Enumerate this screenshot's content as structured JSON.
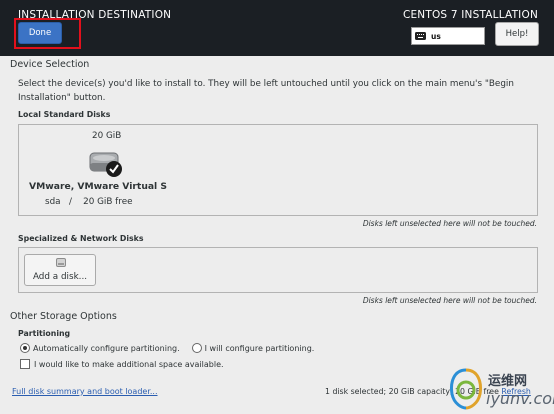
{
  "header": {
    "title": "INSTALLATION DESTINATION",
    "product": "CENTOS 7 INSTALLATION",
    "done_label": "Done",
    "keyboard_layout": "us",
    "help_label": "Help!"
  },
  "device_selection": {
    "title": "Device Selection",
    "description": "Select the device(s) you'd like to install to.  They will be left untouched until you click on the main menu's \"Begin Installation\" button.",
    "local_disks_title": "Local Standard Disks",
    "disk": {
      "size": "20 GiB",
      "name": "VMware, VMware Virtual S",
      "info": "sda   /    20 GiB free"
    },
    "local_note": "Disks left unselected here will not be touched.",
    "network_title": "Specialized & Network Disks",
    "add_disk_label": "Add a disk...",
    "network_note": "Disks left unselected here will not be touched."
  },
  "other_storage": {
    "title": "Other Storage Options",
    "partitioning_title": "Partitioning",
    "auto_partition_label": "Automatically configure partitioning.",
    "manual_partition_label": "I will configure partitioning.",
    "extra_space_label": "I would like to make additional space available."
  },
  "footer": {
    "summary_link": "Full disk summary and boot loader...",
    "status_text": "1 disk selected; 20 GiB capacity; 20 GiB free",
    "refresh_label": "Refresh"
  },
  "watermark": {
    "cn_text": "运维网",
    "en_text": "iyunv.com"
  },
  "colors": {
    "header_bg": "#1b1f24",
    "done_button": "#3b73c5",
    "highlight_box": "#e2101c",
    "link": "#2a5db0"
  },
  "icons": [
    "keyboard-icon",
    "hard-disk-icon",
    "selected-check-icon",
    "add-disk-icon"
  ]
}
